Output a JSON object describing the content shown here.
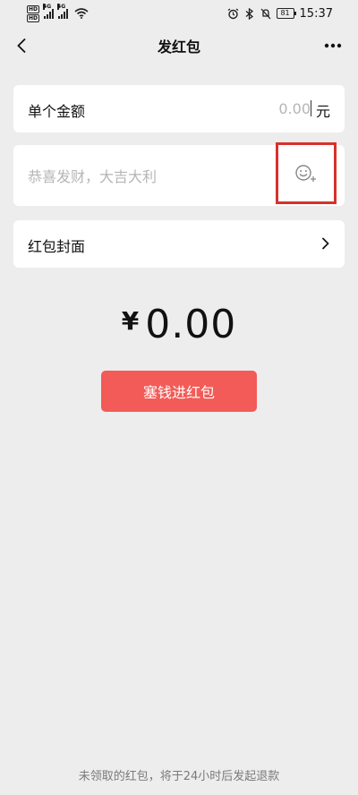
{
  "status_bar": {
    "hd1": "HD",
    "hd2": "HD",
    "net1": "4G",
    "net2": "4G",
    "battery": "81",
    "time": "15:37"
  },
  "nav": {
    "title": "发红包",
    "back_icon": "chevron-left-icon",
    "more_icon": "more-icon"
  },
  "amount": {
    "label": "单个金额",
    "placeholder": "0.00",
    "value": "",
    "unit": "元"
  },
  "greeting": {
    "placeholder": "恭喜发财，大吉大利",
    "value": "",
    "emoji_icon": "emoji-add-icon",
    "highlight_color": "#d9302b"
  },
  "cover": {
    "label": "红包封面",
    "chevron_icon": "chevron-right-icon"
  },
  "total": {
    "currency_symbol": "¥",
    "value": "0.00"
  },
  "submit": {
    "label": "塞钱进红包",
    "color": "#f25b57"
  },
  "footer": {
    "note": "未领取的红包，将于24小时后发起退款"
  }
}
